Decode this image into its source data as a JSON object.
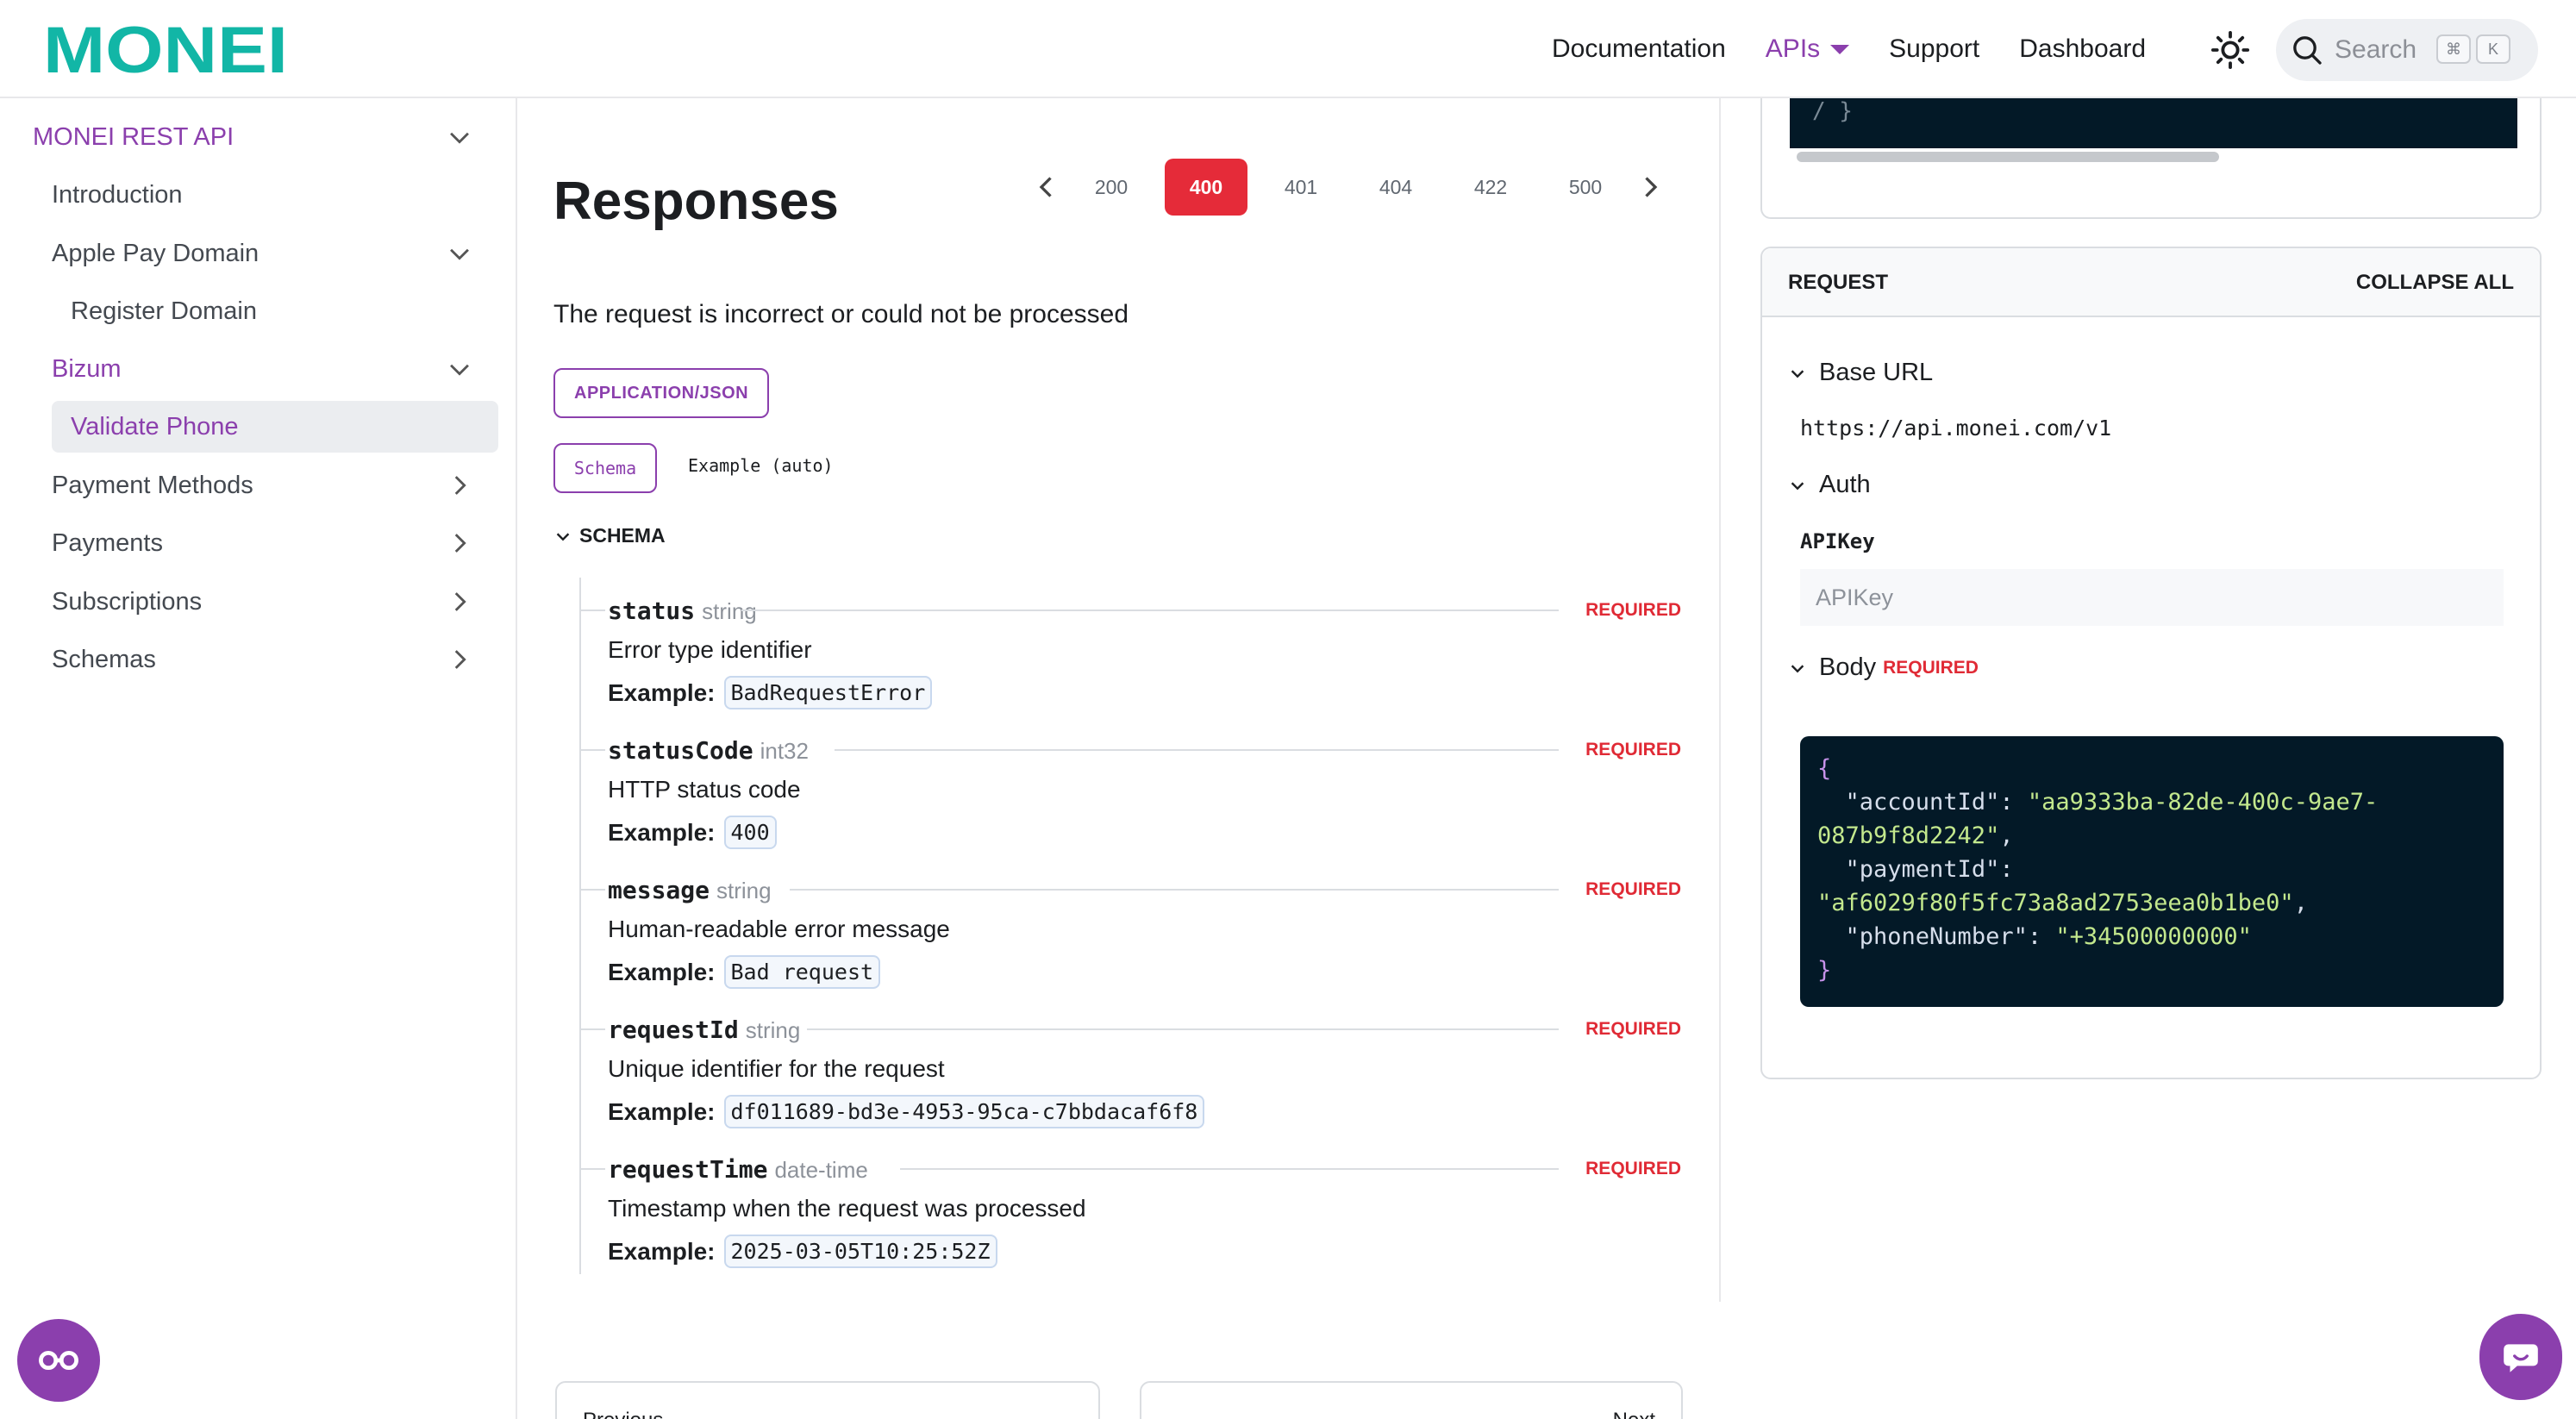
{
  "header": {
    "brand": "MONEI",
    "nav": {
      "documentation": "Documentation",
      "apis": "APIs",
      "support": "Support",
      "dashboard": "Dashboard"
    },
    "search": {
      "placeholder": "Search",
      "kbd_mod": "⌘",
      "kbd_key": "K"
    }
  },
  "sidebar": {
    "root": "MONEI REST API",
    "items": [
      {
        "label": "Introduction"
      },
      {
        "label": "Apple Pay Domain"
      },
      {
        "label": "Register Domain"
      },
      {
        "label": "Bizum"
      },
      {
        "label": "Validate Phone"
      },
      {
        "label": "Payment Methods"
      },
      {
        "label": "Payments"
      },
      {
        "label": "Subscriptions"
      },
      {
        "label": "Schemas"
      }
    ]
  },
  "responses": {
    "title": "Responses",
    "codes": [
      "200",
      "400",
      "401",
      "404",
      "422",
      "500"
    ],
    "active_code": "400",
    "description": "The request is incorrect or could not be processed",
    "media_type": "APPLICATION/JSON",
    "tabs": {
      "schema": "Schema",
      "example": "Example (auto)"
    },
    "schema_label": "SCHEMA",
    "example_prefix": "Example:",
    "required_label": "REQUIRED",
    "properties": [
      {
        "name": "status",
        "type": "string",
        "description": "Error type identifier",
        "example": "BadRequestError"
      },
      {
        "name": "statusCode",
        "type": "int32",
        "description": "HTTP status code",
        "example": "400"
      },
      {
        "name": "message",
        "type": "string",
        "description": "Human-readable error message",
        "example": "Bad request"
      },
      {
        "name": "requestId",
        "type": "string",
        "description": "Unique identifier for the request",
        "example": "df011689-bd3e-4953-95ca-c7bbdacaf6f8"
      },
      {
        "name": "requestTime",
        "type": "date-time",
        "description": "Timestamp when the request was processed",
        "example": "2025-03-05T10:25:52Z"
      }
    ],
    "pager": {
      "previous": "Previous",
      "next": "Next"
    }
  },
  "request_panel": {
    "code_top_snippet": "/  }",
    "title": "REQUEST",
    "collapse_all": "COLLAPSE ALL",
    "base_url_label": "Base URL",
    "base_url": "https://api.monei.com/v1",
    "auth_label": "Auth",
    "apikey_label": "APIKey",
    "apikey_placeholder": "APIKey",
    "body_label": "Body",
    "body_required": "REQUIRED",
    "body": {
      "open": "{",
      "close": "}",
      "accountId_key": "\"accountId\"",
      "accountId_val_1": "\"aa9333ba-82de-400c-9ae7-",
      "accountId_val_2": "087b9f8d2242\"",
      "paymentId_key": "\"paymentId\"",
      "paymentId_val": "\"af6029f80f5fc73a8ad2753eea0b1be0\"",
      "phoneNumber_key": "\"phoneNumber\"",
      "phoneNumber_val": "\"+34500000000\""
    }
  },
  "colors": {
    "brand": "#12b6a6",
    "accent": "#8b3fad",
    "active_code": "#e52b39",
    "required": "#e02a35",
    "code_bg": "#031927"
  }
}
